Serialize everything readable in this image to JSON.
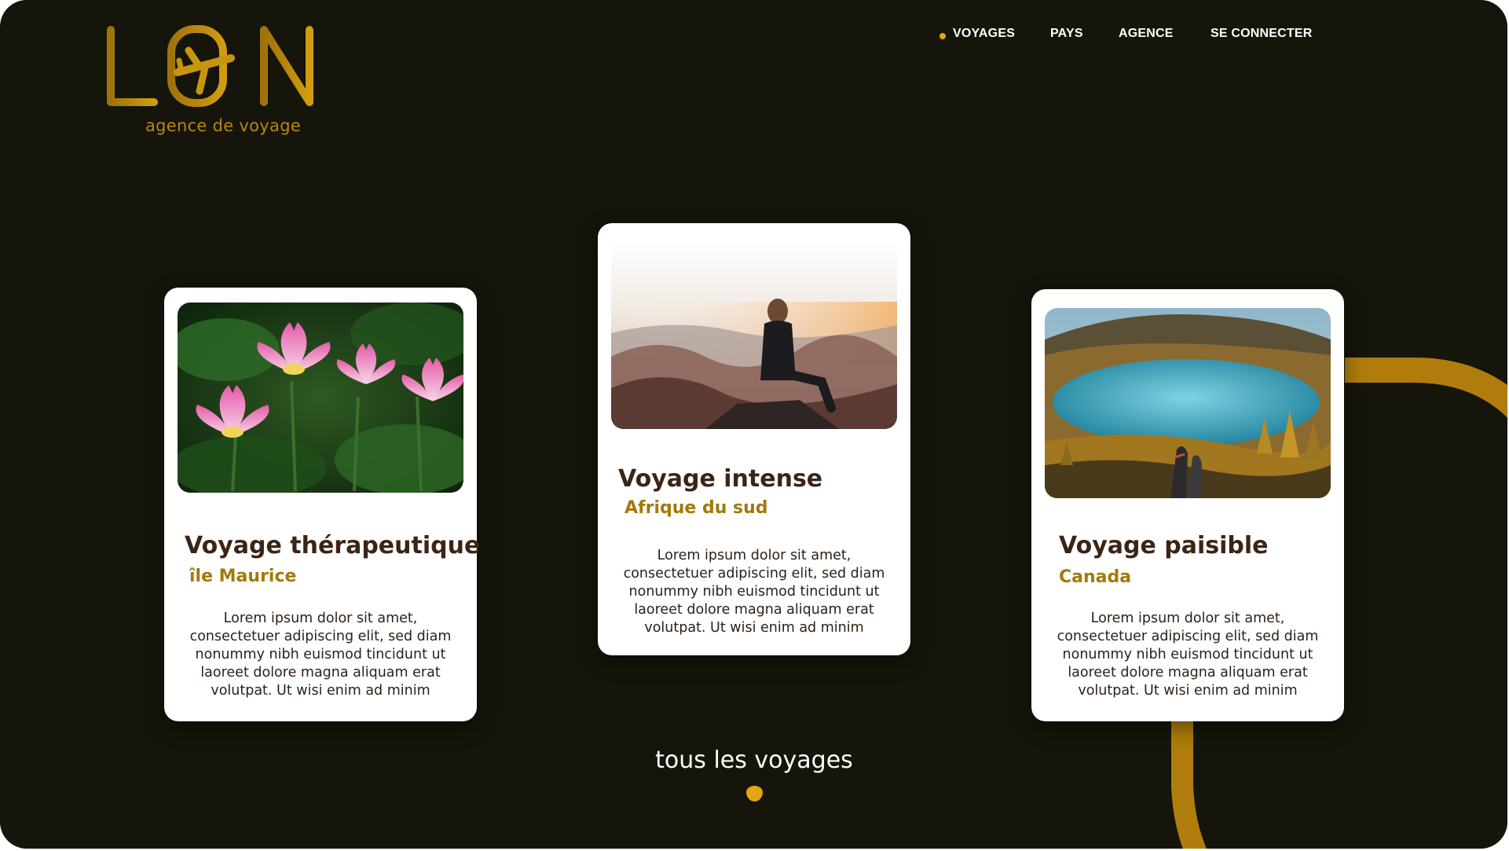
{
  "brand": {
    "name": "LOIN",
    "tagline": "agence de voyage",
    "color": "#b9860f"
  },
  "nav": {
    "items": [
      {
        "label": "VOYAGES",
        "active": true
      },
      {
        "label": "PAYS",
        "active": false
      },
      {
        "label": "AGENCE",
        "active": false
      },
      {
        "label": "SE CONNECTER",
        "active": false
      }
    ],
    "active_dot_color": "#e2a613"
  },
  "cards": [
    {
      "title": "Voyage thérapeutique",
      "location": "île Maurice",
      "text": "Lorem ipsum dolor sit amet, consectetuer adipiscing elit, sed diam nonummy nibh euismod tincidunt ut laoreet dolore magna aliquam erat volutpat. Ut wisi enim ad minim",
      "image": "pink-lotus-flowers"
    },
    {
      "title": "Voyage intense",
      "location": "Afrique du sud",
      "text": "Lorem ipsum dolor sit amet, consectetuer adipiscing elit, sed diam nonummy nibh euismod tincidunt ut laoreet dolore magna aliquam erat volutpat. Ut wisi enim ad minim",
      "image": "woman-on-mountain-top"
    },
    {
      "title": "Voyage paisible",
      "location": "Canada",
      "text": "Lorem ipsum dolor sit amet, consectetuer adipiscing elit, sed diam nonummy nibh euismod tincidunt ut laoreet dolore magna aliquam erat volutpat. Ut wisi enim ad minim",
      "image": "blue-lake-autumn-forest"
    }
  ],
  "footer_link": {
    "label": "tous les voyages"
  },
  "colors": {
    "background": "#15150b",
    "accent": "#e2a613",
    "gold": "#b9860f",
    "title": "#3b2416",
    "subtitle": "#a4790b"
  }
}
